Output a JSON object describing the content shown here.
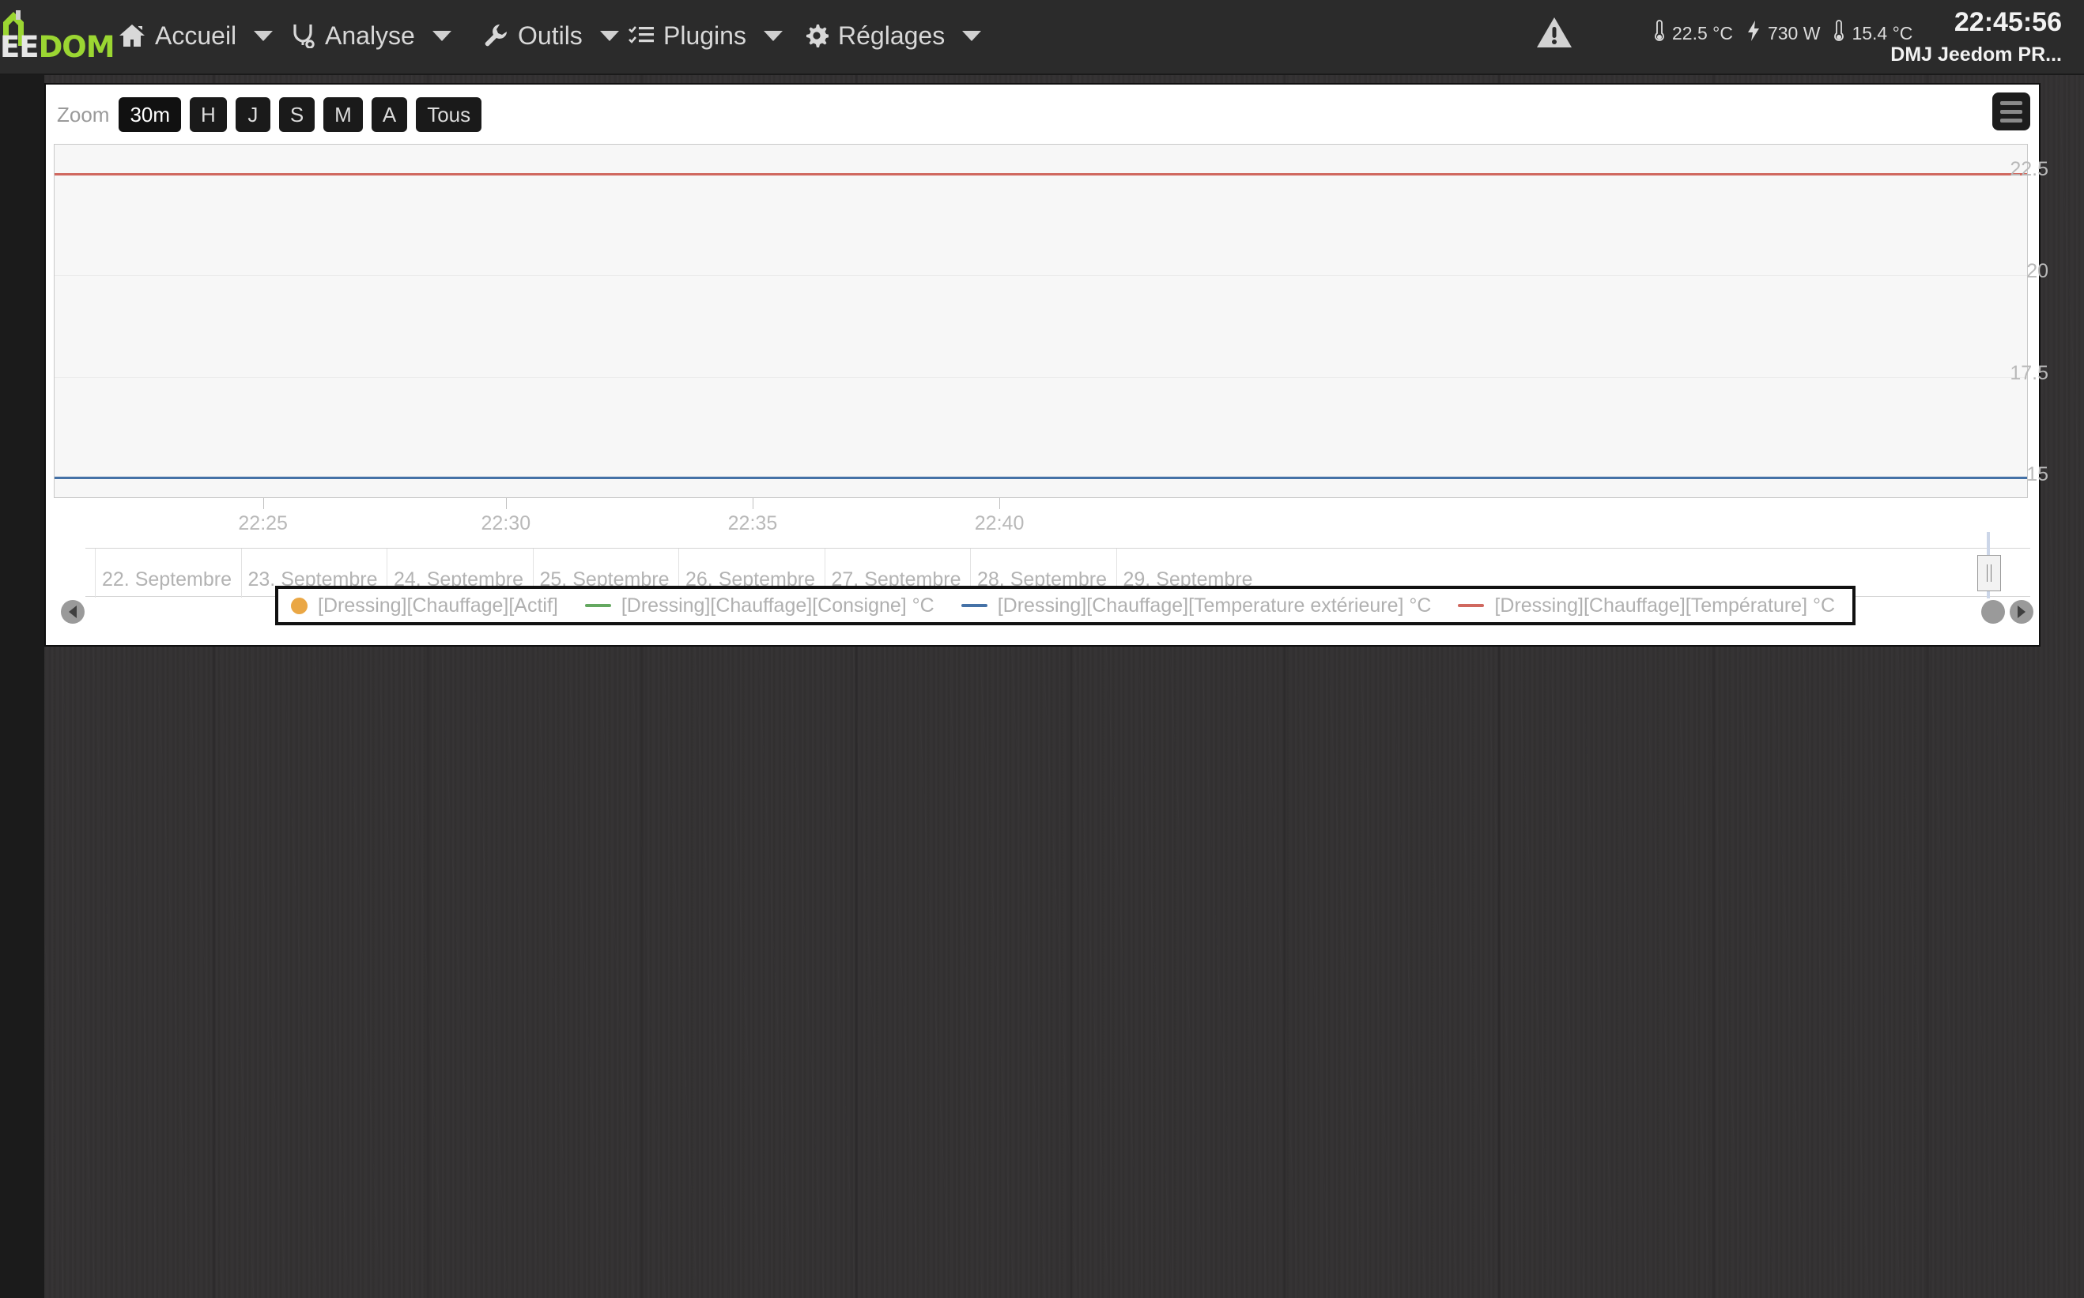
{
  "header": {
    "logo": {
      "part1": "EE",
      "part2": "DOM"
    },
    "nav": [
      {
        "label": "Accueil",
        "icon": "home-icon"
      },
      {
        "label": "Analyse",
        "icon": "stethoscope-icon"
      },
      {
        "label": "Outils",
        "icon": "wrench-icon"
      },
      {
        "label": "Plugins",
        "icon": "checklist-icon"
      },
      {
        "label": "Réglages",
        "icon": "gear-icon"
      }
    ],
    "warning_icon": "warning-triangle-icon",
    "sensors": [
      {
        "icon": "thermometer-icon",
        "value": "22.5 °C"
      },
      {
        "icon": "bolt-icon",
        "value": "730 W"
      },
      {
        "icon": "thermometer-icon",
        "value": "15.4 °C"
      }
    ],
    "clock": "22:45:56",
    "user": "DMJ Jeedom PR..."
  },
  "chart_panel": {
    "zoom_label": "Zoom",
    "range_buttons": [
      {
        "label": "30m",
        "selected": true
      },
      {
        "label": "H",
        "selected": false
      },
      {
        "label": "J",
        "selected": false
      },
      {
        "label": "S",
        "selected": false
      },
      {
        "label": "M",
        "selected": false
      },
      {
        "label": "A",
        "selected": false
      },
      {
        "label": "Tous",
        "selected": false
      }
    ],
    "context_menu_icon": "hamburger-menu-icon",
    "navigator_handle_icon": "range-handle-icon",
    "scroll_left_icon": "chevron-left-icon",
    "scroll_right_icon": "chevron-right-icon"
  },
  "chart_data": {
    "type": "line",
    "title": "",
    "xlabel": "",
    "ylabel": "",
    "grid": true,
    "legend_position": "bottom",
    "ylim": [
      14.5,
      23.2
    ],
    "yticks": [
      "22.5",
      "20",
      "17.5",
      "15"
    ],
    "ytick_values": [
      22.5,
      20,
      17.5,
      15
    ],
    "xticks": [
      "22:25",
      "22:30",
      "22:35",
      "22:40"
    ],
    "xtick_fractions": [
      0.106,
      0.229,
      0.354,
      0.479
    ],
    "series": [
      {
        "name": "[Dressing][Chauffage][Actif]",
        "color": "#eaa745",
        "symbol": "dot",
        "values": []
      },
      {
        "name": "[Dressing][Chauffage][Consigne] °C",
        "color": "#64a860",
        "symbol": "line",
        "values": []
      },
      {
        "name": "[Dressing][Chauffage][Temperature extérieure] °C",
        "color": "#4572a7",
        "symbol": "line",
        "constant_value": 15.0
      },
      {
        "name": "[Dressing][Chauffage][Température] °C",
        "color": "#d0685f",
        "symbol": "line",
        "constant_value": 22.5
      }
    ],
    "navigator": {
      "labels": [
        "22. Septembre",
        "23. Septembre",
        "24. Septembre",
        "25. Septembre",
        "26. Septembre",
        "27. Septembre",
        "28. Septembre",
        "29. Septembre"
      ]
    }
  }
}
